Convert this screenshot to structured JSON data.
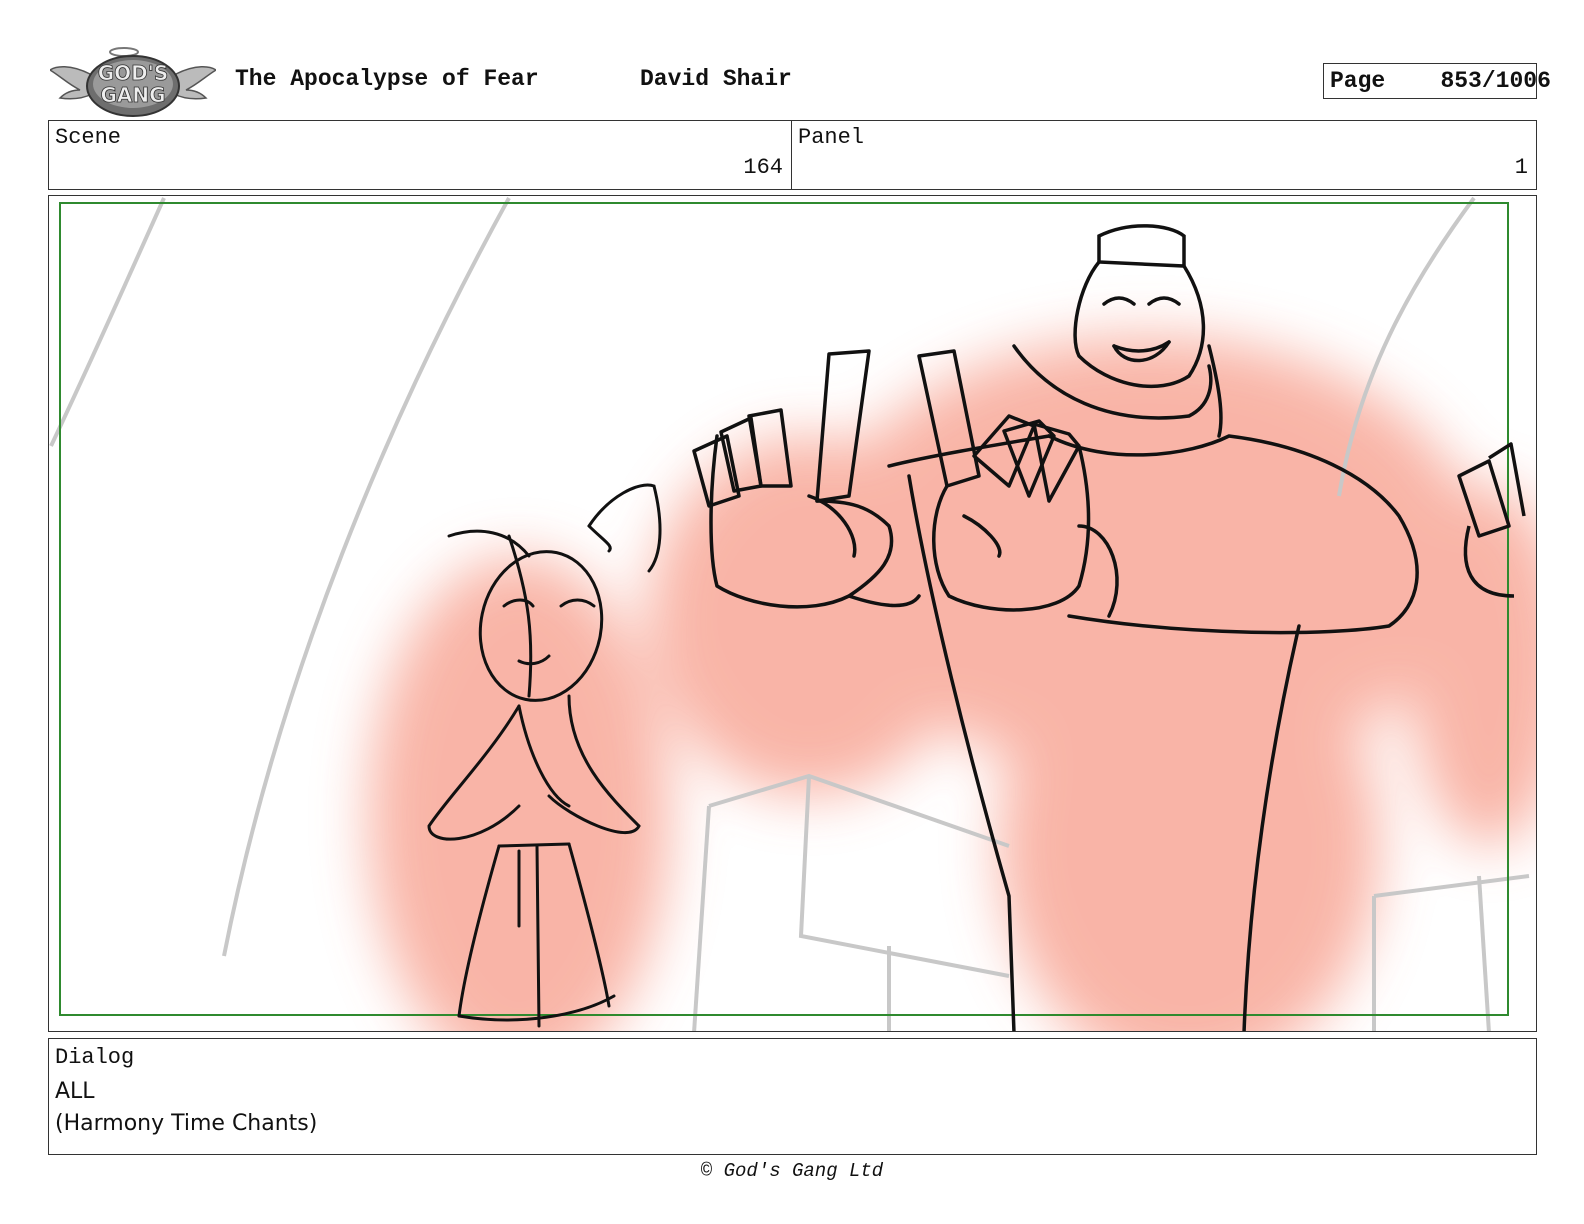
{
  "header": {
    "logo_text": "GOD'S GANG",
    "title": "The Apocalypse of Fear",
    "author": "David Shair",
    "page_label": "Page",
    "page_value": "853/1006"
  },
  "meta": {
    "scene_label": "Scene",
    "scene_value": "164",
    "panel_label": "Panel",
    "panel_value": "1"
  },
  "dialog": {
    "label": "Dialog",
    "speaker": "ALL",
    "line": "(Harmony Time Chants)"
  },
  "footer": {
    "copyright": "© God's Gang Ltd"
  }
}
